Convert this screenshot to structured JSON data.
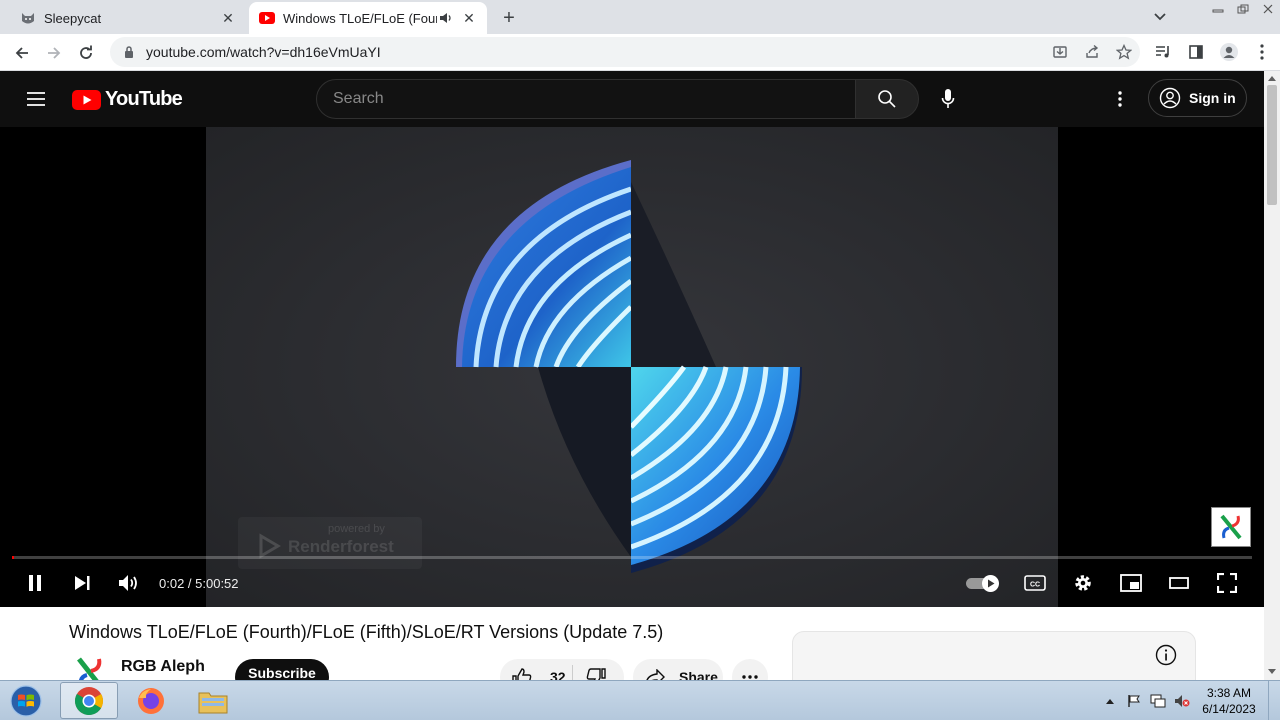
{
  "browser": {
    "tabs": [
      {
        "title": "Sleepycat",
        "favicon": "cat-favicon-icon",
        "active": false
      },
      {
        "title": "Windows TLoE/FLoE (Fourth)",
        "favicon": "youtube-favicon-icon",
        "active": true,
        "audio": true
      }
    ],
    "url": "youtube.com/watch?v=dh16eVmUaYI"
  },
  "youtube": {
    "logo_text": "YouTube",
    "search_placeholder": "Search",
    "sign_in_label": "Sign in"
  },
  "player": {
    "time_display": "0:02 / 5:00:52",
    "progress_fraction": 0.0001,
    "watermark_line1": "powered by",
    "watermark_line2": "Renderforest",
    "autoplay_on": true
  },
  "video": {
    "title": "Windows TLoE/FLoE (Fourth)/FLoE (Fifth)/SLoE/RT Versions (Update 7.5)",
    "channel_name": "RGB Aleph",
    "subscribe_label": "Subscribe",
    "like_count": "32",
    "share_label": "Share"
  },
  "taskbar": {
    "time": "3:38 AM",
    "date": "6/14/2023",
    "apps": [
      "chrome-icon",
      "firefox-icon",
      "file-explorer-icon"
    ]
  },
  "colors": {
    "youtube_red": "#ff0000",
    "page_dark": "#0f0f0f",
    "chrome_tabstrip": "#dee1e6",
    "taskbar": "#b4c8dc"
  }
}
